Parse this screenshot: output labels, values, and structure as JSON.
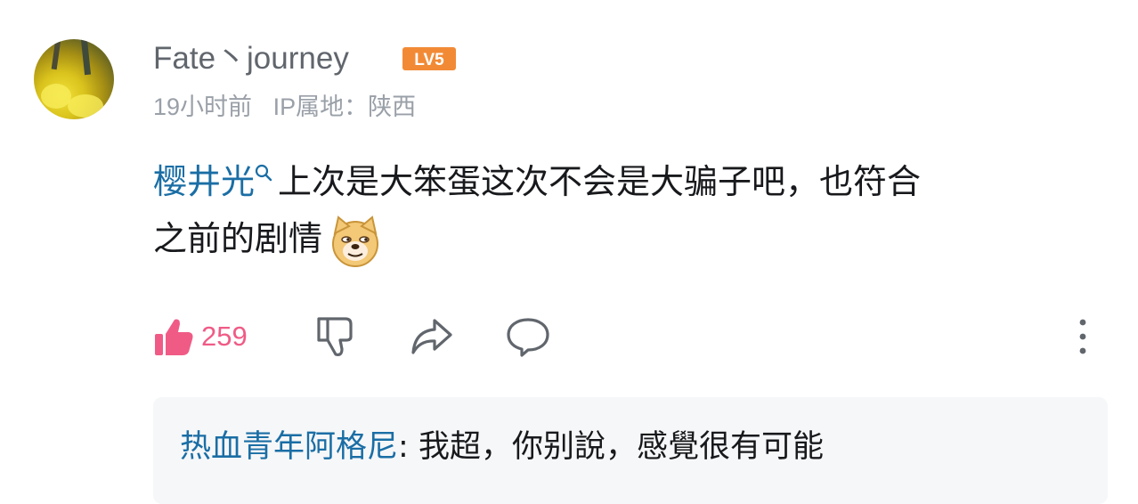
{
  "comment": {
    "username": "Fate丶journey",
    "level_badge": "LV5",
    "time": "19小时前",
    "ip_location": "IP属地：陕西",
    "mention": "樱井光",
    "text_line1": "上次是大笨蛋这次不会是大骗子吧，也符合",
    "text_line2": "之前的剧情",
    "emoji": "doge-emoji",
    "like_count": "259"
  },
  "icons": {
    "like": "thumbs-up-icon",
    "dislike": "thumbs-down-icon",
    "share": "share-icon",
    "reply": "comment-icon",
    "more": "more-vertical-icon",
    "mention_search": "search-icon"
  },
  "colors": {
    "accent_blue": "#1a6ea5",
    "like_pink": "#f05b86",
    "level_orange": "#f28a35",
    "meta_gray": "#9aa0a8"
  },
  "reply": {
    "username": "热血青年阿格尼",
    "separator": ": ",
    "text": "我超，你别說，感覺很有可能"
  }
}
